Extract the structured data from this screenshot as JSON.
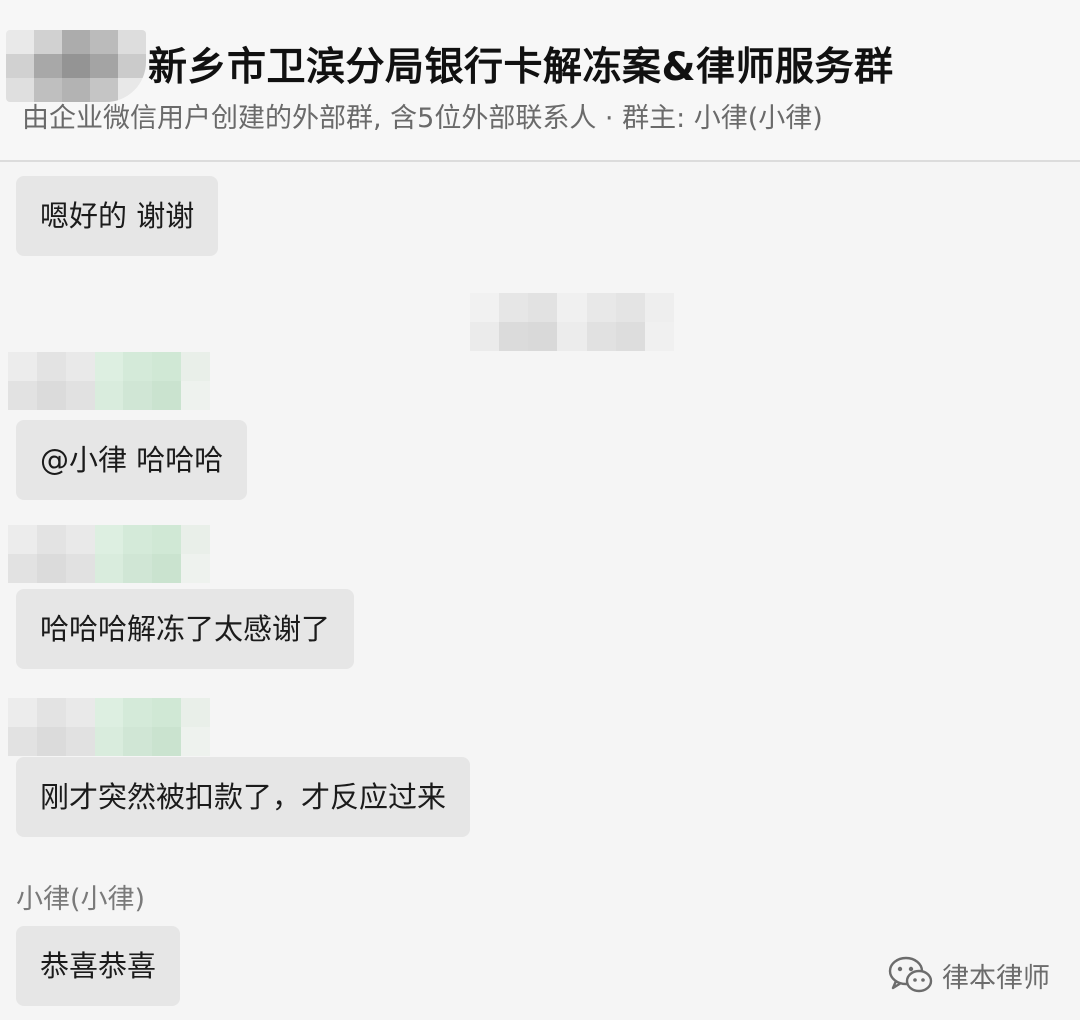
{
  "header": {
    "title": "新乡市卫滨分局银行卡解冻案&律师服务群",
    "subtitle": "由企业微信用户创建的外部群, 含5位外部联系人 · 群主: 小律(小律)"
  },
  "messages": [
    {
      "text": "嗯好的 谢谢"
    },
    {
      "text": "@小律 哈哈哈"
    },
    {
      "text": "哈哈哈解冻了太感谢了"
    },
    {
      "text": "刚才突然被扣款了，才反应过来"
    },
    {
      "sender": "小律(小律)",
      "text": "恭喜恭喜"
    }
  ],
  "watermark": {
    "icon": "wechat-icon",
    "text": "律本律师"
  },
  "colors": {
    "background": "#f5f5f5",
    "bubble": "#e6e6e6",
    "subtitle": "#6a6a6a",
    "title": "#111111"
  }
}
